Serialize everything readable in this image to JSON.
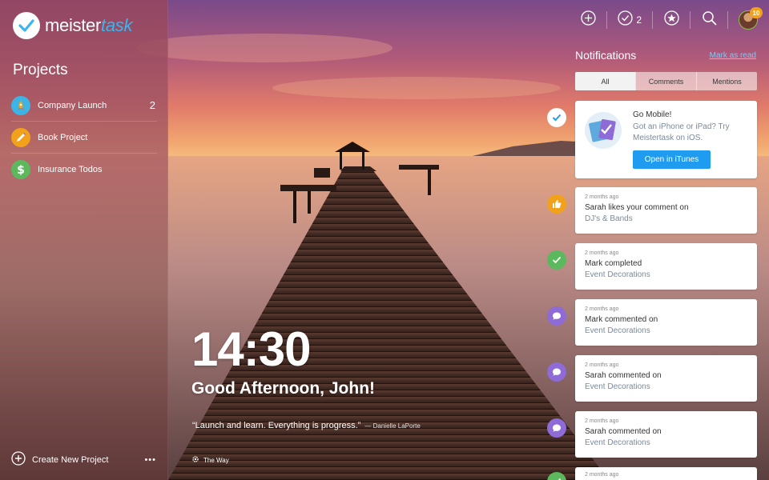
{
  "app": {
    "logo_word1": "meister",
    "logo_word2": "task",
    "brand_color": "#38b6ef"
  },
  "sidebar": {
    "heading": "Projects",
    "projects": [
      {
        "label": "Company Launch",
        "count": "2",
        "icon": "rocket-icon",
        "color": "#3cb4e6"
      },
      {
        "label": "Book Project",
        "count": "",
        "icon": "pencil-icon",
        "color": "#f2a21a"
      },
      {
        "label": "Insurance Todos",
        "count": "",
        "icon": "dollar-icon",
        "color": "#5cb85c"
      }
    ],
    "create_label": "Create New Project",
    "more_label": "•••"
  },
  "center": {
    "time": "14:30",
    "greeting": "Good Afternoon, John!",
    "quote": "“Launch and learn. Everything is progress.”",
    "quote_author": "— Danielle LaPorte",
    "photo_credit": "The Way"
  },
  "topbar": {
    "tasks_count": "2",
    "avatar_badge": "10",
    "icons": [
      "add-icon",
      "check-circle-icon",
      "star-icon",
      "search-icon"
    ]
  },
  "notifications": {
    "title": "Notifications",
    "mark_read": "Mark as read",
    "tabs": [
      "All",
      "Comments",
      "Mentions"
    ],
    "active_tab": "All",
    "promo": {
      "title": "Go Mobile!",
      "text": "Got an iPhone or iPad? Try Meistertask on iOS.",
      "button": "Open in iTunes",
      "status_icon": "check-icon",
      "status_color": "#ffffff"
    },
    "items": [
      {
        "time": "2 months ago",
        "line1": "Sarah likes your comment on",
        "line2": "DJ's & Bands",
        "icon": "thumbs-up-icon",
        "color": "#f2a21a"
      },
      {
        "time": "2 months ago",
        "line1": "Mark completed",
        "line2": "Event Decorations",
        "icon": "check-icon",
        "color": "#5cb85c"
      },
      {
        "time": "2 months ago",
        "line1": "Mark commented on",
        "line2": "Event Decorations",
        "icon": "comment-icon",
        "color": "#8e6bd6"
      },
      {
        "time": "2 months ago",
        "line1": "Sarah commented on",
        "line2": "Event Decorations",
        "icon": "comment-icon",
        "color": "#8e6bd6"
      },
      {
        "time": "2 months ago",
        "line1": "Sarah commented on",
        "line2": "Event Decorations",
        "icon": "comment-icon",
        "color": "#8e6bd6"
      },
      {
        "time": "2 months ago",
        "line1": "",
        "line2": "",
        "icon": "check-icon",
        "color": "#5cb85c"
      }
    ]
  }
}
